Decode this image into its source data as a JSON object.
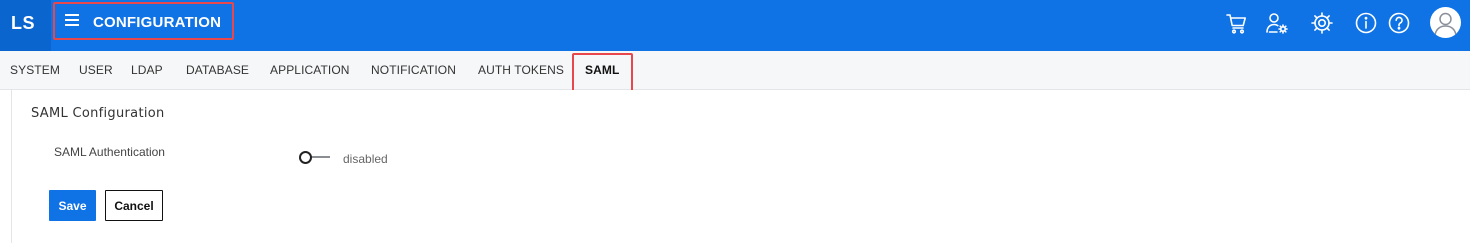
{
  "header": {
    "logo": "LS",
    "title": "CONFIGURATION",
    "icons": [
      "cart-icon",
      "user-settings-icon",
      "gear-icon",
      "info-icon",
      "help-icon",
      "avatar-icon"
    ],
    "brand_color": "#0f72e5",
    "highlight_color": "#e8474c"
  },
  "tabs": [
    {
      "label": "SYSTEM",
      "active": false
    },
    {
      "label": "USER",
      "active": false
    },
    {
      "label": "LDAP",
      "active": false
    },
    {
      "label": "DATABASE",
      "active": false
    },
    {
      "label": "APPLICATION",
      "active": false
    },
    {
      "label": "NOTIFICATION",
      "active": false
    },
    {
      "label": "AUTH TOKENS",
      "active": false
    },
    {
      "label": "SAML",
      "active": true
    }
  ],
  "panel": {
    "title": "SAML Configuration",
    "field_label": "SAML Authentication",
    "toggle_state": "disabled",
    "toggle_on": false
  },
  "actions": {
    "save_label": "Save",
    "cancel_label": "Cancel"
  }
}
